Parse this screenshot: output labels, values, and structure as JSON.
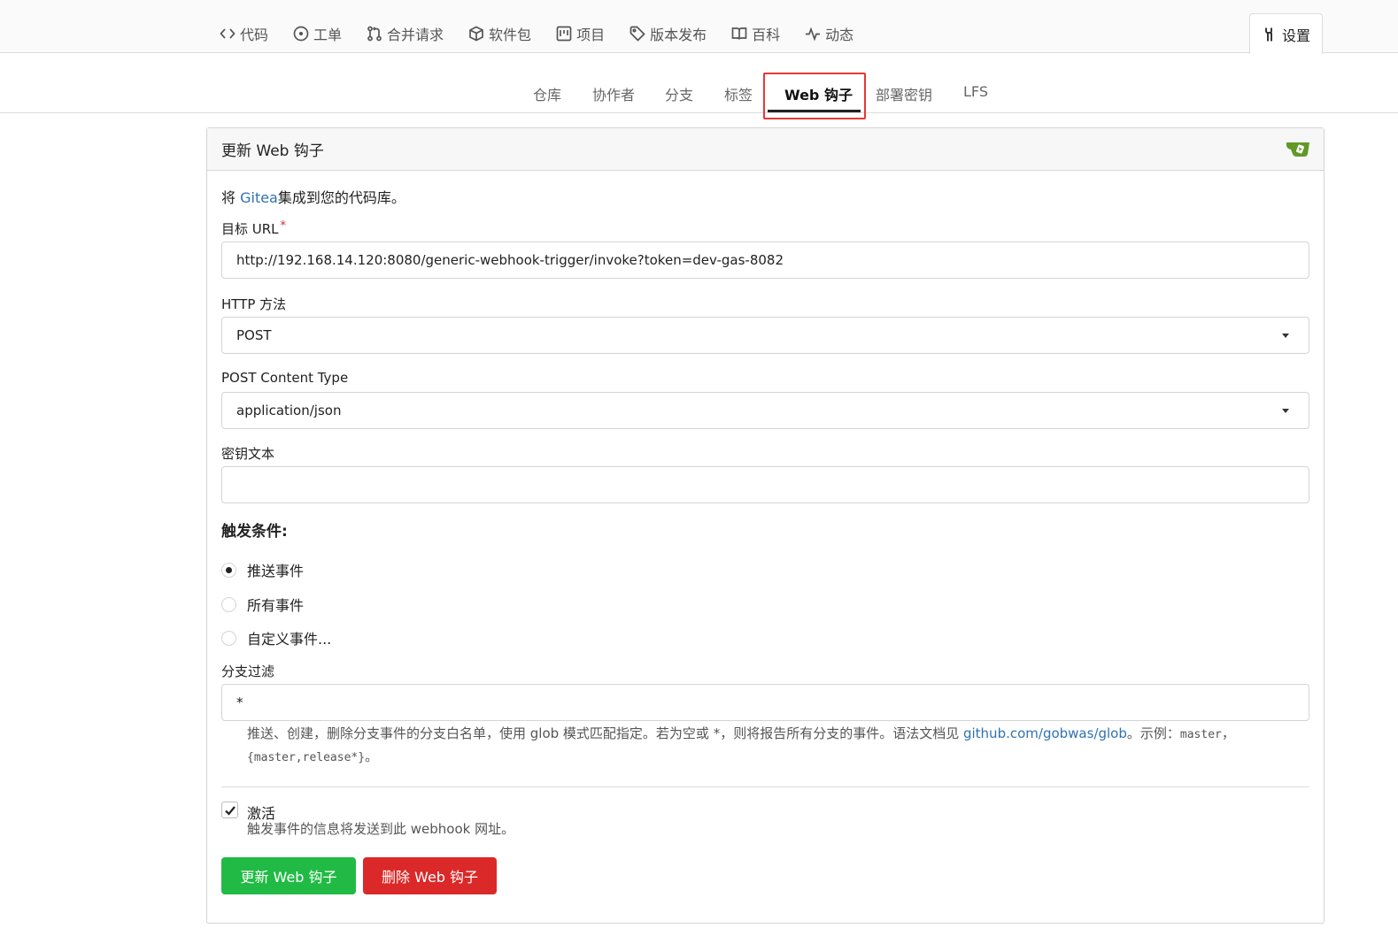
{
  "repo_nav": {
    "items": [
      {
        "label": "代码",
        "icon": "code-icon"
      },
      {
        "label": "工单",
        "icon": "issue-icon"
      },
      {
        "label": "合并请求",
        "icon": "pull-request-icon"
      },
      {
        "label": "软件包",
        "icon": "package-icon"
      },
      {
        "label": "项目",
        "icon": "project-icon"
      },
      {
        "label": "版本发布",
        "icon": "tag-icon"
      },
      {
        "label": "百科",
        "icon": "book-icon"
      },
      {
        "label": "动态",
        "icon": "pulse-icon"
      }
    ],
    "settings": {
      "label": "设置",
      "icon": "tools-icon"
    }
  },
  "sub_nav": {
    "tabs": [
      "仓库",
      "协作者",
      "分支",
      "标签",
      "Web 钩子",
      "部署密钥",
      "LFS"
    ],
    "active": "Web 钩子"
  },
  "panel": {
    "title": "更新 Web 钩子",
    "intro_prefix": "将 ",
    "intro_link": "Gitea",
    "intro_suffix": "集成到您的代码库。"
  },
  "form": {
    "target_url": {
      "label": "目标 URL",
      "required_mark": "*",
      "value": "http://192.168.14.120:8080/generic-webhook-trigger/invoke?token=dev-gas-8082"
    },
    "http_method": {
      "label": "HTTP 方法",
      "value": "POST"
    },
    "content_type": {
      "label": "POST Content Type",
      "value": "application/json"
    },
    "secret": {
      "label": "密钥文本",
      "value": ""
    },
    "trigger": {
      "label": "触发条件:",
      "options": [
        "推送事件",
        "所有事件",
        "自定义事件..."
      ],
      "selected": "推送事件"
    },
    "branch_filter": {
      "label": "分支过滤",
      "value": "*",
      "help_1": "推送、创建，删除分支事件的分支白名单，使用 glob 模式匹配指定。若为空或 ",
      "help_star": "*",
      "help_2": "，则将报告所有分支的事件。语法文档见 ",
      "help_link": "github.com/gobwas/glob",
      "help_3": "。示例：",
      "help_code_1": "master",
      "help_sep": "，",
      "help_code_2": "{master,release*}",
      "help_end": "。"
    },
    "active": {
      "label": "激活",
      "checked": true,
      "description": "触发事件的信息将发送到此 webhook 网址。"
    }
  },
  "buttons": {
    "update": "更新 Web 钩子",
    "delete": "删除 Web 钩子"
  },
  "colors": {
    "green": "#21ba45",
    "red": "#db2828",
    "link": "#2f72b3",
    "highlight": "#e53935"
  }
}
